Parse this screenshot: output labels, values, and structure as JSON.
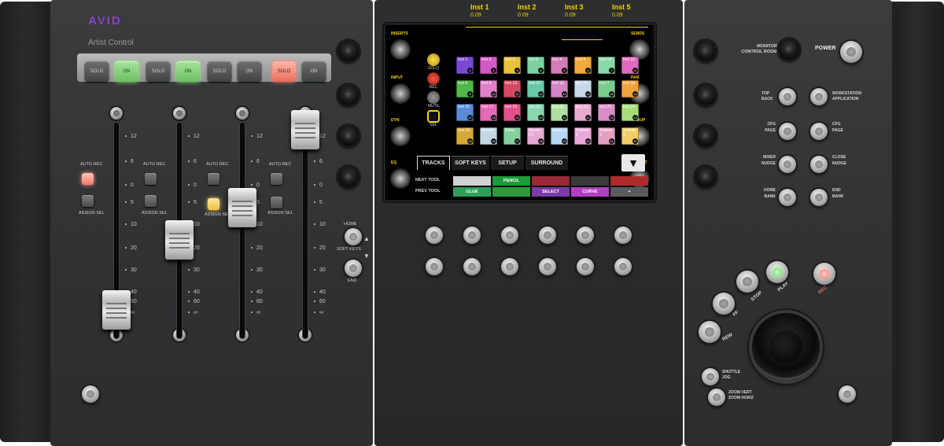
{
  "brand": {
    "logo": "AVID",
    "product": "Artist Control"
  },
  "strip_buttons": [
    "SOLO",
    "ON",
    "SOLO",
    "ON",
    "SOLO",
    "ON",
    "SOLO",
    "ON"
  ],
  "strip_lit": [
    false,
    true,
    false,
    true,
    false,
    false,
    true,
    false
  ],
  "channel_labels": {
    "auto_rec": "AUTO REC",
    "assign_sel": "ASSIGN SEL"
  },
  "fader_scale": [
    "12",
    "6",
    "0",
    "5",
    "10",
    "20",
    "30",
    "40",
    "60",
    "∞"
  ],
  "fader_levels": [
    0.12,
    0.46,
    0.62,
    1.0
  ],
  "soft_keys_nav": {
    "home": "HOME",
    "soft_keys": "SOFT KEYS",
    "end": "END"
  },
  "screen": {
    "left_labels": [
      "INSERTS",
      "INPUT",
      "DYN",
      "EQ"
    ],
    "right_labels": [
      "SENDS",
      "PAN",
      "GROUP",
      "OUTPUT"
    ],
    "tracks": [
      {
        "name": "Inst 1",
        "value": "0.09"
      },
      {
        "name": "Inst 2",
        "value": "0.09"
      },
      {
        "name": "Inst 3",
        "value": "0.09"
      },
      {
        "name": "Inst 5",
        "value": "0.09"
      }
    ],
    "controls": [
      "SOLO",
      "REC",
      "MUTE",
      "SEL"
    ],
    "grid": [
      {
        "label": "Inst 1",
        "color": "#7a48d6",
        "n": "1"
      },
      {
        "label": "Inst 2",
        "color": "#d25ac2",
        "n": "2"
      },
      {
        "label": "Inst 3",
        "color": "#e8c23a",
        "n": "3"
      },
      {
        "label": "Inst 5",
        "color": "#7ad0a0",
        "n": "4"
      },
      {
        "label": "Inst 4",
        "color": "#d67ab8",
        "n": "5"
      },
      {
        "label": "Inst 6",
        "color": "#f2a83a",
        "n": "6"
      },
      {
        "label": "Inst 14",
        "color": "#8ad8a6",
        "n": "7"
      },
      {
        "label": "Inst 12",
        "color": "#e06cc0",
        "n": "8"
      },
      {
        "label": "Inst 8",
        "color": "#4fb84a",
        "n": "9"
      },
      {
        "label": "Inst 9",
        "color": "#e080c8",
        "n": "10"
      },
      {
        "label": "Inst 13",
        "color": "#d44a62",
        "n": "11"
      },
      {
        "label": "Inst 10",
        "color": "#6ac8a8",
        "n": "12"
      },
      {
        "label": "Inst 16",
        "color": "#d286c6",
        "n": "13"
      },
      {
        "label": "Inst 15",
        "color": "#c6d8e8",
        "n": "14"
      },
      {
        "label": "Inst 7",
        "color": "#7acc8a",
        "n": "15"
      },
      {
        "label": "Inst 18",
        "color": "#f0a43c",
        "n": "16"
      },
      {
        "label": "Inst 20",
        "color": "#5a8ad8",
        "n": "17"
      },
      {
        "label": "Inst 17",
        "color": "#e46ab4",
        "n": "18"
      },
      {
        "label": "Inst 19",
        "color": "#e2508a",
        "n": "19"
      },
      {
        "label": "Inst 22",
        "color": "#8ad6b0",
        "n": "20"
      },
      {
        "label": "Inst 21",
        "color": "#b0e0a0",
        "n": "21"
      },
      {
        "label": "Inst 23",
        "color": "#e8aad0",
        "n": "22"
      },
      {
        "label": "Inst 25",
        "color": "#d88ec4",
        "n": "23"
      },
      {
        "label": "Inst 24",
        "color": "#a6dc7a",
        "n": "24"
      },
      {
        "label": "Inst 24",
        "color": "#d6a838",
        "n": "25"
      },
      {
        "label": "Reverb",
        "color": "#c4d8e4",
        "n": "26"
      },
      {
        "label": "Delay",
        "color": "#86d0a0",
        "n": "27"
      },
      {
        "label": "Master FX",
        "color": "#e6a8d2",
        "n": "28"
      },
      {
        "label": "Subm 1",
        "color": "#b6d8f0",
        "n": "29"
      },
      {
        "label": "Submix 2",
        "color": "#e8a8d8",
        "n": "30"
      },
      {
        "label": "Submix 3",
        "color": "#e4a0c0",
        "n": "31"
      },
      {
        "label": "Submix 4",
        "color": "#f2cc66",
        "n": "32"
      }
    ],
    "tabs": [
      "TRACKS",
      "SOFT KEYS",
      "SETUP",
      "SURROUND"
    ],
    "next_tool": "NEXT TOOL",
    "prev_tool": "PREV TOOL",
    "tools_row1": [
      {
        "label": "",
        "color": "#d0d0d0"
      },
      {
        "label": "PENCIL",
        "color": "#1e9a3a"
      },
      {
        "label": "",
        "color": "#9a2a3a"
      },
      {
        "label": "",
        "color": "#3a3a3a"
      },
      {
        "label": "",
        "color": "#b02a2a"
      }
    ],
    "tools_row2": [
      {
        "label": "GLUE",
        "color": "#2ea05a"
      },
      {
        "label": "",
        "color": "#2e9a3a"
      },
      {
        "label": "SELECT",
        "color": "#7a3aa8"
      },
      {
        "label": "CURVE",
        "color": "#b040c0"
      },
      {
        "label": "+",
        "color": "#5a5a5a"
      }
    ],
    "dropdown": "▼"
  },
  "right_labels": {
    "monitor": "MONITOR CONTROL ROOM",
    "power": "POWER",
    "top": "TOP BACK",
    "workstation": "WORKSTATION APPLICATION",
    "cfg_page_left": "CFG PAGE",
    "cfg_page_right": "CFG PAGE",
    "mixer_nudge": "MIXER NUDGE",
    "close_nudge": "CLOSE NUDGE",
    "home_bank": "HOME BANK",
    "end_bank": "END BANK",
    "play": "PLAY",
    "stop": "STOP",
    "ff": "FF",
    "rew": "REW",
    "rec": "REC",
    "shuttle_jog": "SHUTTLE JOG",
    "zoom": "ZOOM VERT ZOOM HORIZ"
  }
}
